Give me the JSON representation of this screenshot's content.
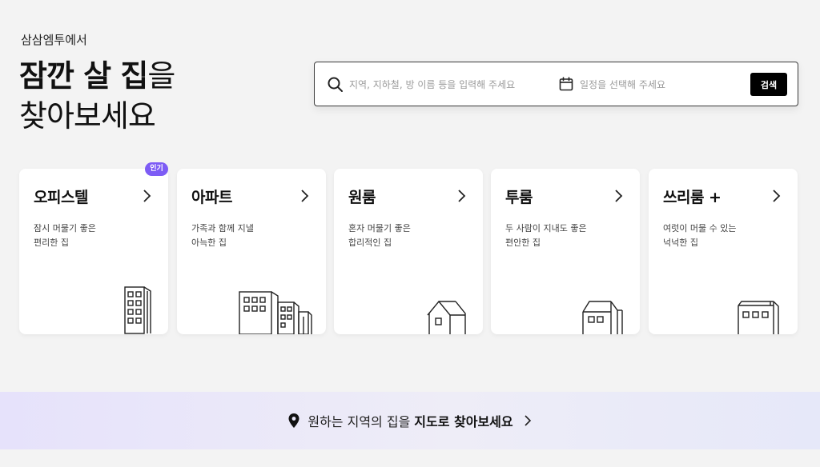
{
  "hero": {
    "subtitle": "삼삼엠투에서",
    "title_bold": "잠깐 살 집",
    "title_suffix": "을",
    "title_line2": "찾아보세요"
  },
  "search": {
    "location_placeholder": "지역, 지하철, 방 이름 등을 입력해 주세요",
    "date_placeholder": "일정을 선택해 주세요",
    "button_label": "검색",
    "search_icon": "search-icon",
    "calendar_icon": "calendar-icon"
  },
  "categories": [
    {
      "title": "오피스텔",
      "desc1": "잠시 머물기 좋은",
      "desc2": "편리한 집",
      "icon": "officetel-building-icon",
      "badge": "인기"
    },
    {
      "title": "아파트",
      "desc1": "가족과 함께 지낼",
      "desc2": "아늑한 집",
      "icon": "apartment-buildings-icon"
    },
    {
      "title": "원룸",
      "desc1": "혼자 머물기 좋은",
      "desc2": "합리적인 집",
      "icon": "small-house-icon"
    },
    {
      "title": "투룸",
      "desc1": "두 사람이 지내도 좋은",
      "desc2": "편안한 집",
      "icon": "two-window-house-icon"
    },
    {
      "title": "쓰리룸 +",
      "desc1": "여럿이 머물 수 있는",
      "desc2": "넉넉한 집",
      "icon": "three-window-house-icon"
    }
  ],
  "map_banner": {
    "text": "원하는 지역의 집을",
    "strong": "지도로 찾아보세요",
    "icon": "location-pin-icon"
  },
  "colors": {
    "background": "#f3f3f3",
    "badge": "#7d5cf5",
    "button": "#000000",
    "banner_start": "#e6e2fb",
    "banner_end": "#e6e8f9"
  }
}
